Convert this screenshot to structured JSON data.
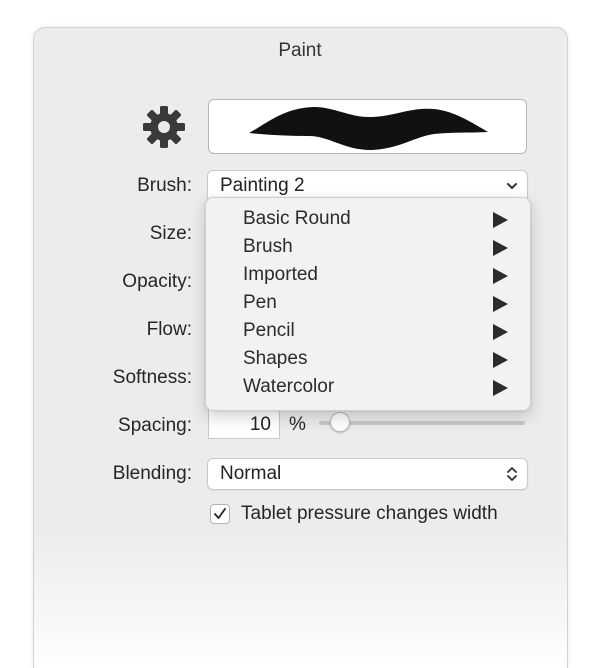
{
  "window": {
    "title": "Paint"
  },
  "icons": {
    "settings": "gear-icon",
    "brush_preview": "brush-stroke-preview"
  },
  "labels": {
    "brush": "Brush:",
    "size": "Size:",
    "opacity": "Opacity:",
    "flow": "Flow:",
    "softness": "Softness:",
    "spacing": "Spacing:",
    "blending": "Blending:"
  },
  "brush": {
    "selected": "Painting 2"
  },
  "brush_menu": {
    "items": [
      {
        "label": "Basic Round"
      },
      {
        "label": "Brush"
      },
      {
        "label": "Imported"
      },
      {
        "label": "Pen"
      },
      {
        "label": "Pencil"
      },
      {
        "label": "Shapes"
      },
      {
        "label": "Watercolor"
      }
    ]
  },
  "spacing": {
    "value": "10",
    "unit": "%",
    "slider_fraction": 0.1
  },
  "blending": {
    "selected": "Normal"
  },
  "tablet_pressure": {
    "label": "Tablet pressure changes width",
    "checked": true
  }
}
